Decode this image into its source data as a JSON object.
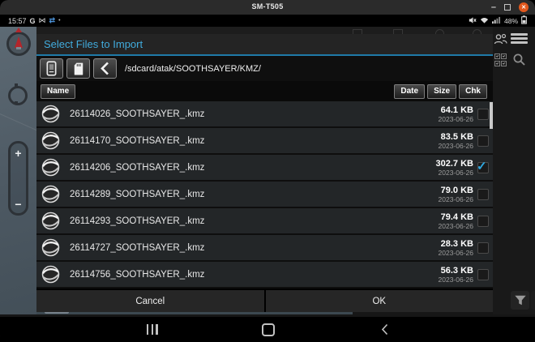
{
  "window": {
    "title": "SM-T505",
    "controls": {
      "minimize": "–",
      "close": "✕"
    }
  },
  "status": {
    "time": "15:57",
    "network_type": "G",
    "pair_glyph": "⋈",
    "sync_glyph": "⇄",
    "dot_glyph": "•",
    "battery_percent": "48%"
  },
  "dialog": {
    "title": "Select Files to Import",
    "path": "/sdcard/atak/SOOTHSAYER/KMZ/",
    "columns": {
      "name": "Name",
      "date": "Date",
      "size": "Size",
      "chk": "Chk"
    },
    "files": [
      {
        "name": "26114026_SOOTHSAYER_.kmz",
        "size": "64.1 KB",
        "date": "2023-06-26",
        "checked": false
      },
      {
        "name": "26114170_SOOTHSAYER_.kmz",
        "size": "83.5 KB",
        "date": "2023-06-26",
        "checked": false
      },
      {
        "name": "26114206_SOOTHSAYER_.kmz",
        "size": "302.7 KB",
        "date": "2023-06-26",
        "checked": true
      },
      {
        "name": "26114289_SOOTHSAYER_.kmz",
        "size": "79.0 KB",
        "date": "2023-06-26",
        "checked": false
      },
      {
        "name": "26114293_SOOTHSAYER_.kmz",
        "size": "79.4 KB",
        "date": "2023-06-26",
        "checked": false
      },
      {
        "name": "26114727_SOOTHSAYER_.kmz",
        "size": "28.3 KB",
        "date": "2023-06-26",
        "checked": false
      },
      {
        "name": "26114756_SOOTHSAYER_.kmz",
        "size": "56.3 KB",
        "date": "2023-06-26",
        "checked": false
      }
    ],
    "buttons": {
      "cancel": "Cancel",
      "ok": "OK"
    }
  },
  "icons": {
    "plus": "+",
    "minus": "−"
  },
  "colors": {
    "title_blue": "#41abdd",
    "title_underline": "#1f7aa8",
    "check_blue": "#2fa9e1",
    "close_orange": "#e2581d",
    "red_x": "#bb2127",
    "map_slate": "#52606a"
  }
}
